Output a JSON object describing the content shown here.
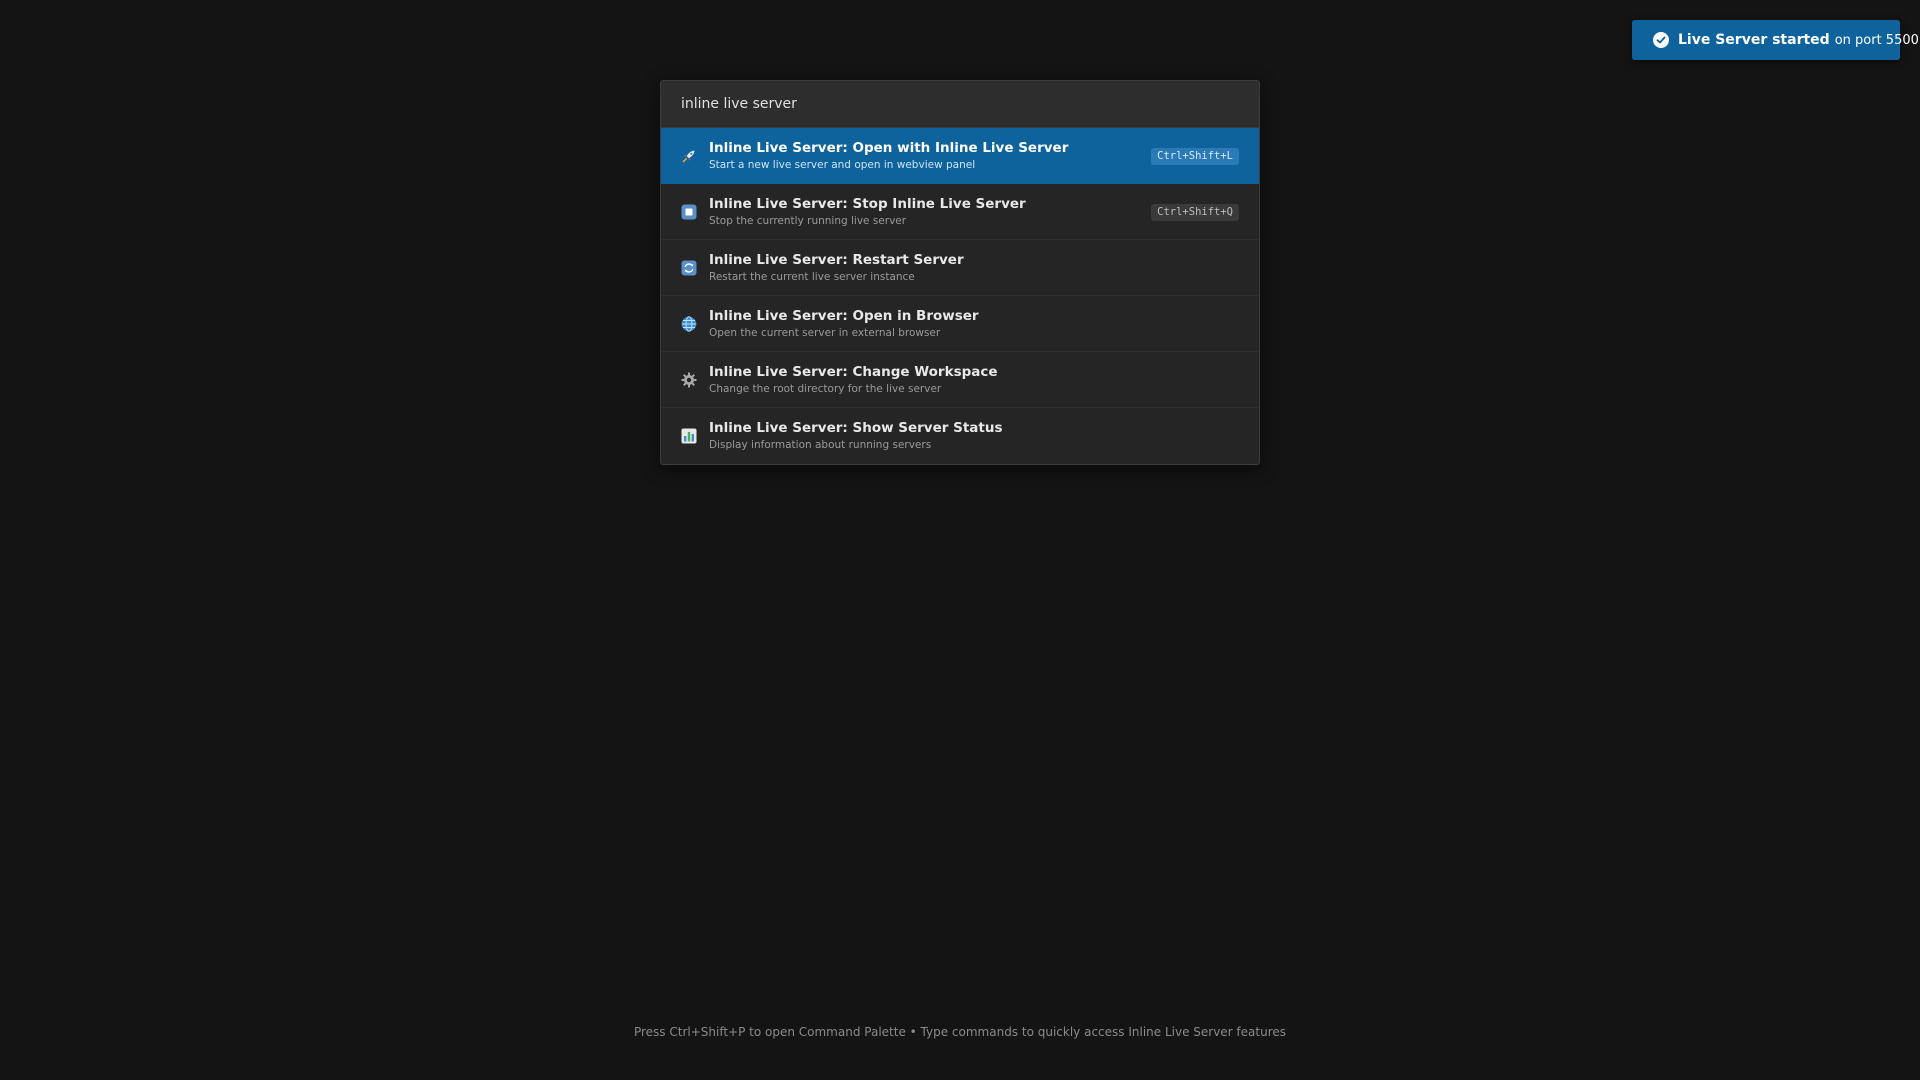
{
  "toast": {
    "bold_text": "Live Server started",
    "rest_text": "on port 5500",
    "icon": "check-circle-icon"
  },
  "palette": {
    "search_value": "inline live server",
    "items": [
      {
        "label": "Inline Live Server: Open with Inline Live Server",
        "description": "Start a new live server and open in webview panel",
        "shortcut": "Ctrl+Shift+L",
        "icon": "rocket-icon",
        "selected": true
      },
      {
        "label": "Inline Live Server: Stop Inline Live Server",
        "description": "Stop the currently running live server",
        "shortcut": "Ctrl+Shift+Q",
        "icon": "stop-icon"
      },
      {
        "label": "Inline Live Server: Restart Server",
        "description": "Restart the current live server instance",
        "icon": "refresh-icon"
      },
      {
        "label": "Inline Live Server: Open in Browser",
        "description": "Open the current server in external browser",
        "icon": "globe-icon"
      },
      {
        "label": "Inline Live Server: Change Workspace",
        "description": "Change the root directory for the live server",
        "icon": "gear-icon"
      },
      {
        "label": "Inline Live Server: Show Server Status",
        "description": "Display information about running servers",
        "icon": "bar-chart-icon"
      }
    ]
  },
  "footer": {
    "hint": "Press Ctrl+Shift+P to open Command Palette • Type commands to quickly access Inline Live Server features"
  },
  "colors": {
    "background": "#141414",
    "accent": "#0e639c",
    "palette_bg": "#252526"
  }
}
